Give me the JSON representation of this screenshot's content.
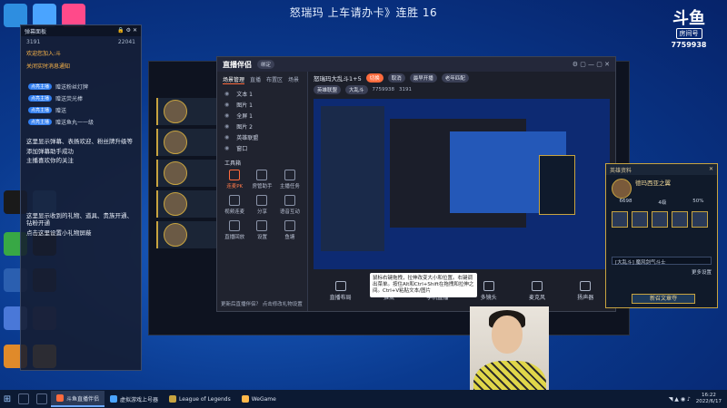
{
  "stream": {
    "title": "怒瑞玛 上车请办卡》连胜 16"
  },
  "platform_logo": {
    "glyph": "斗鱼",
    "room_label": "房间号",
    "room_number": "7759938"
  },
  "chat_panel": {
    "header_left": "弹幕面板",
    "header_right": "🔒 ⚙ ✕",
    "stat_left": "3191",
    "stat_right": "22041",
    "system_lines": [
      "欢迎您加入:斗",
      "关闭实时消息通知"
    ],
    "gift_tags": [
      "点亮主播",
      "点亮主播",
      "点亮主播",
      "点亮主播"
    ],
    "gift_texts": [
      "赠送粉丝灯牌",
      "赠送荧光棒",
      "赠送",
      "赠送鱼丸一一级"
    ],
    "messages": [
      "这里显示弹幕、表扬欢迎、粉丝牌升级等",
      "添加弹幕助手成功",
      "主播喜欢你的关注",
      "这里显示收到的礼物、道具、贵族开通、钻粉开通",
      "点击这里设置小礼物屏蔽"
    ]
  },
  "tool": {
    "brand": "直播伴侣",
    "version_badge": "绑定",
    "tabs": [
      "场景管理",
      "直播",
      "布置区",
      "场景"
    ],
    "layers": [
      "文本 1",
      "图片 1",
      "全屏 1",
      "图片 2",
      "英雄联盟",
      "窗口"
    ],
    "tools_title": "工具箱",
    "tools": [
      {
        "label": "连麦PK"
      },
      {
        "label": "房管助手"
      },
      {
        "label": "主播任务"
      },
      {
        "label": "视频连麦"
      },
      {
        "label": "分享"
      },
      {
        "label": "语音互动"
      },
      {
        "label": "直播回放"
      },
      {
        "label": "设置"
      },
      {
        "label": "鱼塘"
      }
    ],
    "notice": "更新后直播伴侣？ 点击修改礼物设置",
    "room_name": "怒瑞玛大乱斗1+5",
    "room_buttons": [
      "切换",
      "取消",
      "最早开播",
      "老年匹配"
    ],
    "category_left": "英雄联盟",
    "category_right": "大乱斗",
    "room_id": "7759938",
    "room_viewers": "3191",
    "bottom_buttons": [
      "直播布局",
      "推流",
      "手机直播",
      "多镜头",
      "麦克风",
      "扬声器"
    ],
    "hint": "鼠标右键拖拽，拉伸改变大小和位置。右键调出菜单。按住Alt和Ctrl+Shift在拖拽和拉伸之间。Ctrl+V粘贴文本/图片"
  },
  "hero_panel": {
    "title": "英雄资料",
    "champion": "德玛西亚之翼",
    "stats": [
      "6698",
      "4级",
      "50%"
    ],
    "select_text": "[大乱斗] 魔风剑气斗士",
    "button": "新召文章夺",
    "clone_button": "更多设置"
  },
  "taskbar": {
    "tasks": [
      "斗鱼直播伴侣",
      "虚拟游戏上号器",
      "League of Legends",
      "WeGame"
    ],
    "time": "16:22",
    "date": "2022/6/17"
  },
  "colors": {
    "accent": "#ff6b3d",
    "gold": "#c8a440",
    "desktop": "#1b5fc4"
  }
}
